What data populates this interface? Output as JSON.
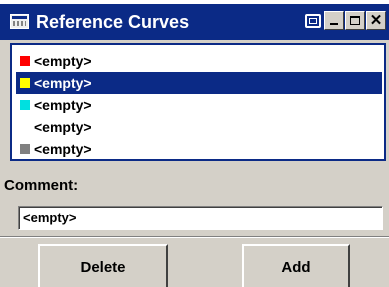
{
  "window": {
    "title": "Reference Curves",
    "controls": {
      "close": "✕"
    }
  },
  "curves": {
    "items": [
      {
        "label": "<empty>",
        "color": "#ff0000",
        "selected": false
      },
      {
        "label": "<empty>",
        "color": "#ffff00",
        "selected": true
      },
      {
        "label": "<empty>",
        "color": "#00e0e0",
        "selected": false
      },
      {
        "label": "<empty>",
        "color": null,
        "selected": false
      },
      {
        "label": "<empty>",
        "color": "#808080",
        "selected": false
      }
    ]
  },
  "comment": {
    "label": "Comment:",
    "value": "<empty>"
  },
  "actions": {
    "delete_label": "Delete",
    "add_label": "Add"
  },
  "colors": {
    "titlebar": "#0b2a86",
    "selection": "#0b2a86",
    "face": "#d4d0c8"
  }
}
